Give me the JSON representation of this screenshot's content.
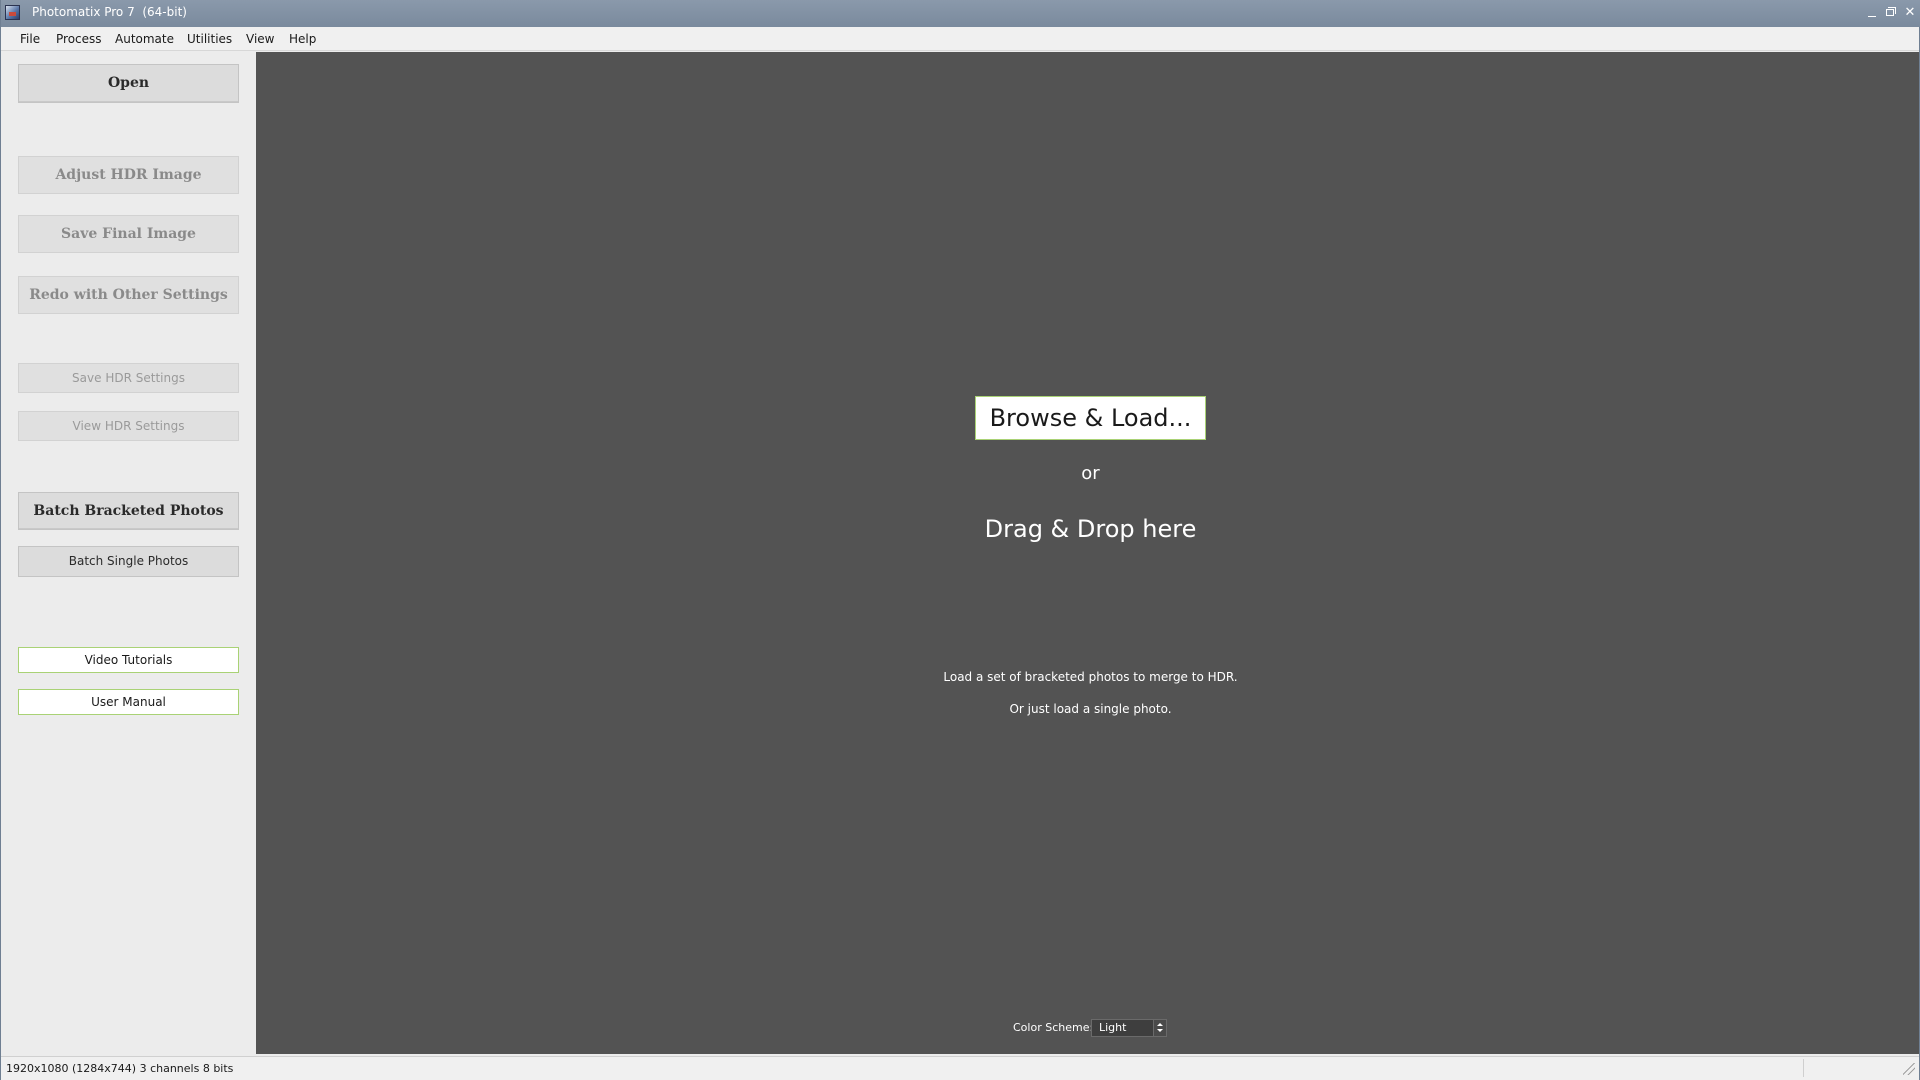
{
  "window": {
    "title": "Photomatix Pro 7  (64-bit)",
    "controls": {
      "minimize": "minimize",
      "maximize": "restore",
      "close": "✕"
    }
  },
  "menubar": {
    "items": [
      {
        "label": "File"
      },
      {
        "label": "Process"
      },
      {
        "label": "Automate"
      },
      {
        "label": "Utilities"
      },
      {
        "label": "View"
      },
      {
        "label": "Help"
      }
    ]
  },
  "sidebar": {
    "open": "Open",
    "adjust_hdr": "Adjust HDR Image",
    "save_final": "Save Final Image",
    "redo": "Redo with Other Settings",
    "save_hdr_settings": "Save HDR Settings",
    "view_hdr_settings": "View HDR Settings",
    "batch_bracketed": "Batch Bracketed Photos",
    "batch_single": "Batch Single Photos",
    "video_tutorials": "Video Tutorials",
    "user_manual": "User Manual"
  },
  "main": {
    "browse_label": "Browse & Load...",
    "or_label": "or",
    "drag_label": "Drag & Drop here",
    "hint_line1": "Load a set of bracketed photos to merge to HDR.",
    "hint_line2": "Or just load a single photo.",
    "color_scheme": {
      "label": "Color Scheme:",
      "value": "Light"
    }
  },
  "statusbar": {
    "info": "1920x1080 (1284x744) 3 channels 8 bits"
  },
  "colors": {
    "titlebar": "#7f8fa2",
    "canvas": "#535353",
    "accent_border": "#a9d275"
  }
}
